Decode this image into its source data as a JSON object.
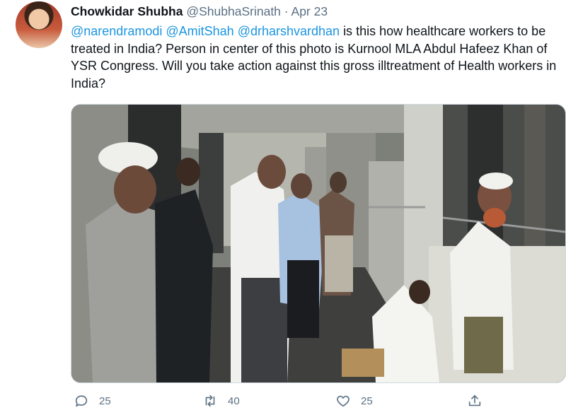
{
  "author": {
    "name": "Chowkidar Shubha",
    "handle": "@ShubhaSrinath",
    "separator": "·",
    "date": "Apr 23"
  },
  "tweet": {
    "mentions": [
      "@narendramodi",
      "@AmitShah",
      "@drharshvardhan"
    ],
    "body": "is this how healthcare workers to be treated in India? Person in center of this photo is Kurnool MLA Abdul Hafeez Khan of YSR Congress.  Will you take action against this gross illtreatment of Health workers in India?"
  },
  "actions": {
    "reply_count": "25",
    "retweet_count": "40",
    "like_count": "25",
    "icons": [
      "reply-icon",
      "retweet-icon",
      "like-icon",
      "share-icon"
    ]
  },
  "colors": {
    "link": "#1b95e0",
    "muted": "#5b7083",
    "text": "#0f1419"
  }
}
